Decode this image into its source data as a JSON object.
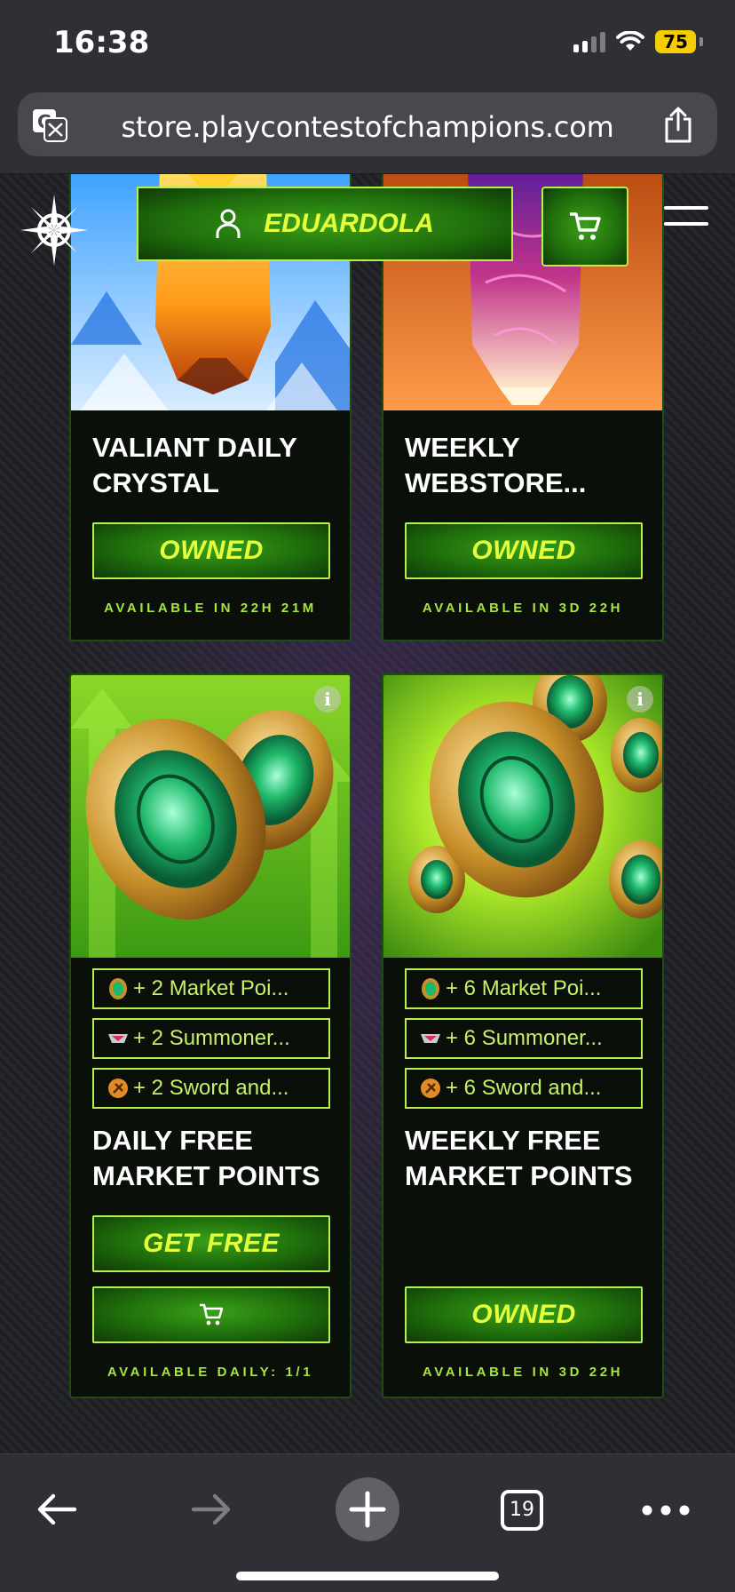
{
  "status_bar": {
    "time": "16:38",
    "battery": "75",
    "icons": [
      "signal-icon",
      "wifi-icon",
      "battery-charging-icon"
    ]
  },
  "browser": {
    "url": "store.playcontestofchampions.com",
    "tab_count": "19",
    "icons": [
      "translate-icon",
      "share-icon",
      "back-arrow-icon",
      "forward-arrow-icon",
      "plus-icon",
      "tabs-icon",
      "more-icon"
    ]
  },
  "header": {
    "username": "EDUARDOLA",
    "icons": [
      "logo-icon",
      "user-icon",
      "cart-icon",
      "menu-icon"
    ]
  },
  "offers": [
    {
      "title_line1": "VALIANT DAILY",
      "title_line2": "CRYSTAL",
      "button_label": "OWNED",
      "availability": "AVAILABLE IN 22H 21M"
    },
    {
      "title_line1": "WEEKLY",
      "title_line2": "WEBSTORE...",
      "button_label": "OWNED",
      "availability": "AVAILABLE IN 3D 22H"
    },
    {
      "rewards": [
        "+ 2 Market Poi...",
        "+ 2 Summoner...",
        "+ 2 Sword and..."
      ],
      "title_line1": "DAILY FREE",
      "title_line2": "MARKET POINTS",
      "button_label": "GET FREE",
      "availability": "AVAILABLE DAILY: 1/1"
    },
    {
      "rewards": [
        "+ 6 Market Poi...",
        "+ 6 Summoner...",
        "+ 6 Sword and..."
      ],
      "title_line1": "WEEKLY FREE",
      "title_line2": "MARKET POINTS",
      "button_label": "OWNED",
      "availability": "AVAILABLE IN 3D 22H"
    }
  ],
  "colors": {
    "accent_green": "#b8f04a",
    "button_text": "#e4ff3a",
    "availability_text": "#a7e63a",
    "card_bg": "#0a0f0a"
  }
}
